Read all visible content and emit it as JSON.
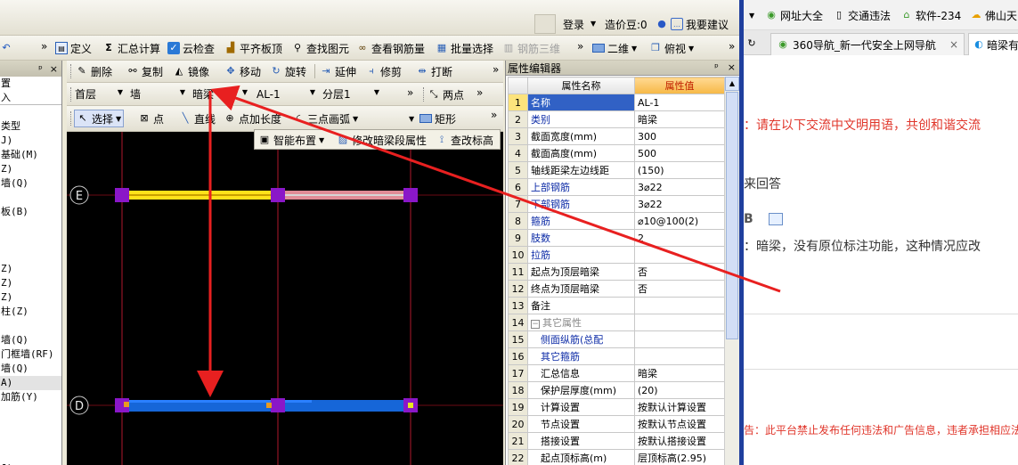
{
  "header": {
    "login": "登录",
    "credits_label": "造价豆:0",
    "suggest": "我要建议"
  },
  "browser": {
    "bookmarks": [
      "网址大全",
      "交通违法",
      "软件-234",
      "佛山天"
    ],
    "tabs": [
      "360导航_新一代安全上网导航",
      "暗梁有"
    ],
    "post_text_1": "：请在以下交流中文明用语，共创和谐交流",
    "post_text_2": "来回答",
    "post_text_3": "：暗梁，没有原位标注功能，这种情况应改",
    "post_text_4": "告：此平台禁止发布任何违法和广告信息，违者承担相应法",
    "bold_btn": "B"
  },
  "toolbar1": {
    "define": "定义",
    "sum": "汇总计算",
    "cloud_check": "云检查",
    "align_top": "平齐板顶",
    "find": "查找图元",
    "view_rebar": "查看钢筋量",
    "batch_select": "批量选择",
    "rebar3d": "钢筋三维",
    "view2d": "二维",
    "viewmode": "俯视",
    "sum_glyph": "Σ"
  },
  "toolbar2": {
    "delete": "删除",
    "copy": "复制",
    "mirror": "镜像",
    "move": "移动",
    "rotate": "旋转",
    "extend": "延伸",
    "trim": "修剪",
    "break": "打断"
  },
  "toolbar3": {
    "floor": "首层",
    "type": "墙",
    "subtype": "暗梁",
    "element": "AL-1",
    "layer": "分层1",
    "two_point": "两点"
  },
  "toolbar4": {
    "select": "选择",
    "point": "点",
    "line": "直线",
    "point_len": "点加长度",
    "arc": "三点画弧",
    "rect": "矩形"
  },
  "popup_toolbar": {
    "smart": "智能布置",
    "modify_seg": "修改暗梁段属性",
    "check_elev": "查改标高"
  },
  "left_panel": {
    "pin": "ᵖ",
    "close": "×",
    "rows": [
      "置",
      "入",
      "",
      "类型",
      "J)",
      "基础(M)",
      "Z)",
      "墙(Q)",
      "",
      "板(B)",
      "",
      "",
      "",
      "Z)",
      "Z)",
      "Z)",
      "柱(Z)",
      "",
      "墙(Q)",
      "门框墙(RF)",
      "墙(Q)",
      "A)",
      "加筋(Y)",
      "",
      "",
      "",
      "",
      "J)"
    ]
  },
  "canvas": {
    "axis_e": "E",
    "axis_d": "D"
  },
  "property_editor": {
    "title": "属性编辑器",
    "pin": "ᵖ",
    "close": "×",
    "col_name": "属性名称",
    "col_value": "属性值",
    "group_toggle": "−",
    "rows": [
      {
        "num": "1",
        "name": "名称",
        "value": "AL-1",
        "blue": false,
        "indent": false
      },
      {
        "num": "2",
        "name": "类别",
        "value": "暗梁",
        "blue": true,
        "indent": false
      },
      {
        "num": "3",
        "name": "截面宽度(mm)",
        "value": "300",
        "blue": false,
        "indent": false
      },
      {
        "num": "4",
        "name": "截面高度(mm)",
        "value": "500",
        "blue": false,
        "indent": false
      },
      {
        "num": "5",
        "name": "轴线距梁左边线距",
        "value": "(150)",
        "blue": false,
        "indent": false
      },
      {
        "num": "6",
        "name": "上部钢筋",
        "value": "3⌀22",
        "blue": true,
        "indent": false
      },
      {
        "num": "7",
        "name": "下部钢筋",
        "value": "3⌀22",
        "blue": true,
        "indent": false
      },
      {
        "num": "8",
        "name": "箍筋",
        "value": "⌀10@100(2)",
        "blue": true,
        "indent": false
      },
      {
        "num": "9",
        "name": "肢数",
        "value": "2",
        "blue": true,
        "indent": false
      },
      {
        "num": "10",
        "name": "拉筋",
        "value": "",
        "blue": true,
        "indent": false
      },
      {
        "num": "11",
        "name": "起点为顶层暗梁",
        "value": "否",
        "blue": false,
        "indent": false
      },
      {
        "num": "12",
        "name": "终点为顶层暗梁",
        "value": "否",
        "blue": false,
        "indent": false
      },
      {
        "num": "13",
        "name": "备注",
        "value": "",
        "blue": false,
        "indent": false
      },
      {
        "num": "14",
        "name": "其它属性",
        "value": "",
        "blue": false,
        "indent": false,
        "group": true
      },
      {
        "num": "15",
        "name": "侧面纵筋(总配",
        "value": "",
        "blue": true,
        "indent": true
      },
      {
        "num": "16",
        "name": "其它箍筋",
        "value": "",
        "blue": true,
        "indent": true
      },
      {
        "num": "17",
        "name": "汇总信息",
        "value": "暗梁",
        "blue": false,
        "indent": true
      },
      {
        "num": "18",
        "name": "保护层厚度(mm)",
        "value": "(20)",
        "blue": false,
        "indent": true
      },
      {
        "num": "19",
        "name": "计算设置",
        "value": "按默认计算设置",
        "blue": false,
        "indent": true
      },
      {
        "num": "20",
        "name": "节点设置",
        "value": "按默认节点设置",
        "blue": false,
        "indent": true
      },
      {
        "num": "21",
        "name": "搭接设置",
        "value": "按默认搭接设置",
        "blue": false,
        "indent": true
      },
      {
        "num": "22",
        "name": "起点顶标高(m)",
        "value": "层顶标高(2.95)",
        "blue": false,
        "indent": true
      }
    ]
  },
  "colors": {
    "beam_yellow": "#ffe21a",
    "beam_pink": "#e08c96",
    "beam_blue": "#1666d8",
    "node_purple": "#8a17c8",
    "annotation_red": "#e82020"
  }
}
